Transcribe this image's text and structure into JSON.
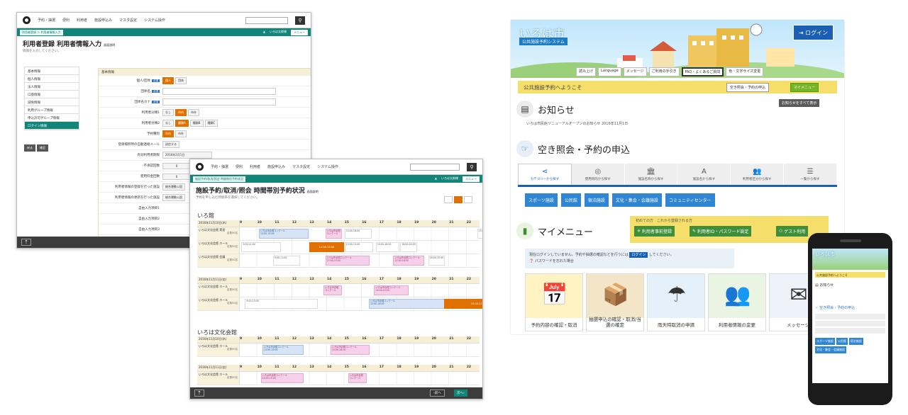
{
  "form_window": {
    "topnav": [
      "予約・抽選",
      "便利",
      "利用者",
      "施設申込み",
      "マスタ設定",
      "システム操作"
    ],
    "breadcrumb": "利用者登録 ＞ 利用者情報入力",
    "topright": [
      "いろは太郎様",
      "メニュー"
    ],
    "title": "利用者登録 利用者情報入力",
    "help": "画面説明",
    "subtitle": "情報を入力してください。",
    "sidebar": [
      "基本情報",
      "個人情報",
      "法人情報",
      "口座情報",
      "減免情報",
      "利用グループ情報",
      "申込許可グループ情報",
      "ログイン情報"
    ],
    "sidebar_active": 7,
    "side_buttons": [
      "戻る",
      "確定"
    ],
    "panel_header": "基本情報",
    "rows": [
      {
        "label": "個人/団体",
        "required": "必須",
        "chips": [
          "個人",
          "団体"
        ],
        "on": 0
      },
      {
        "label": "団体名",
        "required": "必須",
        "input": true
      },
      {
        "label": "団体名カナ",
        "required": "必須",
        "input": true
      },
      {
        "label": "利用者分類1",
        "chips": [
          "なし",
          "市内",
          "市外"
        ],
        "on": 1
      },
      {
        "label": "利用者分類2",
        "chips": [
          "なし",
          "種類A",
          "種類B",
          "種類C"
        ],
        "on": 1
      },
      {
        "label": "予約種別",
        "chips": [
          "市内",
          "市外"
        ],
        "on": 0
      },
      {
        "label": "登録場所時の自動連絡メール",
        "chips": [
          "送信する"
        ],
        "on": -1
      },
      {
        "label": "有効利用者期限",
        "date": "2016年2月1日"
      },
      {
        "label": "不承認回数",
        "stepper": "0"
      },
      {
        "label": "使用料金回数",
        "stepper": "0"
      },
      {
        "label": "利用者情報の登録を行った施設",
        "value": "総合運動公園"
      },
      {
        "label": "利用者情報の更新を行った施設",
        "value": "総合運動公園"
      },
      {
        "label": "自由入力項目1"
      },
      {
        "label": "自由入力項目2"
      },
      {
        "label": "自由入力項目3"
      },
      {
        "label": "自由入力項目4"
      }
    ]
  },
  "schedule_window": {
    "topnav": [
      "予約・抽選",
      "便利",
      "利用者",
      "施設申込み",
      "マスタ設定",
      "システム操作"
    ],
    "breadcrumb": "施設予約/取消/照会 時間帯別予約状況",
    "topright": [
      "いろは太郎様",
      "メニュー"
    ],
    "title": "施設予約/取消/照会 時間帯別予約状況",
    "help": "画面説明",
    "subtitle": "予約を申し込む時間帯を選択してください。",
    "hours": [
      "9",
      "10",
      "11",
      "12",
      "13",
      "14",
      "15",
      "16",
      "17",
      "18",
      "19",
      "20",
      "21",
      "22",
      "2"
    ],
    "venue1": "いろ館",
    "venue2": "いろは文化会館",
    "date1": "2016年11月10日(木)",
    "date2": "2016年11月11日(金)",
    "rooms": [
      {
        "name": "いろは文化会館 実習",
        "cap": "定員50名"
      },
      {
        "name": "いろは文化会館 ホール",
        "cap": "定員50名"
      },
      {
        "name": "いろは文化会館 会議",
        "cap": "定員50名"
      },
      {
        "name": "いろは文化会館 ホール",
        "cap": "定員50名"
      },
      {
        "name": "いろは文化会館 ホール",
        "cap": "定員50名"
      },
      {
        "name": "いろは文化会館 ホール",
        "cap": "定員50名"
      },
      {
        "name": "いろは文化会館 ホール",
        "cap": "定員50名"
      }
    ],
    "blocks": {
      "concert": "いろは市合唱コンクール",
      "t1": "9:00-11:00",
      "t2": "11:00-13:00",
      "t3": "13:00-15:00",
      "t4": "15:00-18:00",
      "t5": "9:00-13:00",
      "t6": "15:00-22:00",
      "t7": "18:00-20:00"
    },
    "prev": "前へ",
    "next": "次へ"
  },
  "portal": {
    "city": "いろは市",
    "system": "公共施設予約システム",
    "login": "ログイン",
    "tools": [
      "読み上げ",
      "Language",
      "メッセージ",
      "ご利用の手引き",
      "FAQ・よくあるご質問",
      "色・文字サイズ変更"
    ],
    "welcome": "公共施設予約へようこそ",
    "welcome_btns": [
      "空き照会・予約の申込",
      "マイメニュー"
    ],
    "news_title": "お知らせ",
    "news_all": "お知らせをすべて表示",
    "news_item": "いろは市民館リニューアルオープンのお知らせ 2016年11月1日",
    "search_title": "空き照会・予約の申込",
    "tabs": [
      {
        "icon": "share-icon",
        "glyph": "⋖",
        "label": "カテゴリーから探す"
      },
      {
        "icon": "purpose-icon",
        "glyph": "◎",
        "label": "使用目的から探す"
      },
      {
        "icon": "building-icon",
        "glyph": "🏛",
        "label": "施設名称から探す"
      },
      {
        "icon": "letter-icon",
        "glyph": "A",
        "label": "施設名から探す"
      },
      {
        "icon": "people-icon",
        "glyph": "👥",
        "label": "利用者区分から探す"
      },
      {
        "icon": "list-icon",
        "glyph": "☰",
        "label": "一覧から探す"
      }
    ],
    "categories": [
      "スポーツ施設",
      "公民館",
      "宿泊施設",
      "文化・集会・会議施設",
      "コミュニティセンター"
    ],
    "mymenu_title": "マイメニュー",
    "guest_title": "初めての方　これから登録される方",
    "guest_btns": [
      "利用者事前登録",
      "利用者ID・パスワード設定",
      "ゲスト利用"
    ],
    "info_text": "現在ログインしていません。予約や抽選の確認などを行うには",
    "info_btn": "ログイン",
    "info_tail": "してください。",
    "forgot": "パスワードを忘れた場合",
    "cards": [
      "予約内容の確認・取消",
      "抽選申込の確認・取消/当選の確定",
      "雨天時取消の申請",
      "利用者情報の変更",
      "メッセージ"
    ]
  },
  "phone": {
    "city": "いろは市",
    "welcome": "公共施設予約へようこそ",
    "news": "お知らせ",
    "search": "空き照会・予約の申込",
    "cats": [
      "スポーツ施設",
      "公民館",
      "宿泊施設",
      "文化・集会・会議施設"
    ]
  }
}
